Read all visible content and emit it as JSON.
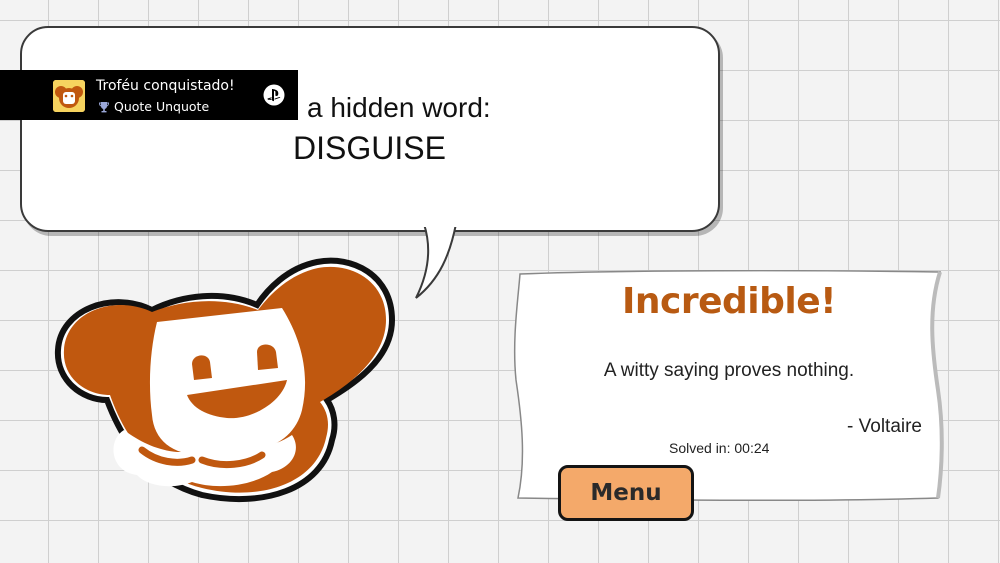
{
  "hint": {
    "line": "a hidden word:",
    "word": "DISGUISE"
  },
  "trophy": {
    "title": "Troféu conquistado!",
    "name": "Quote Unquote",
    "cup_icon": "trophy-icon",
    "platform_icon": "playstation-icon"
  },
  "result": {
    "title": "Incredible!",
    "quote": "A witty saying proves nothing.",
    "author": "- Voltaire",
    "solved": "Solved in: 00:24"
  },
  "menu": {
    "label": "Menu"
  },
  "colors": {
    "accent": "#b85a12",
    "dog_orange": "#c0580f",
    "button": "#f4a96a"
  }
}
